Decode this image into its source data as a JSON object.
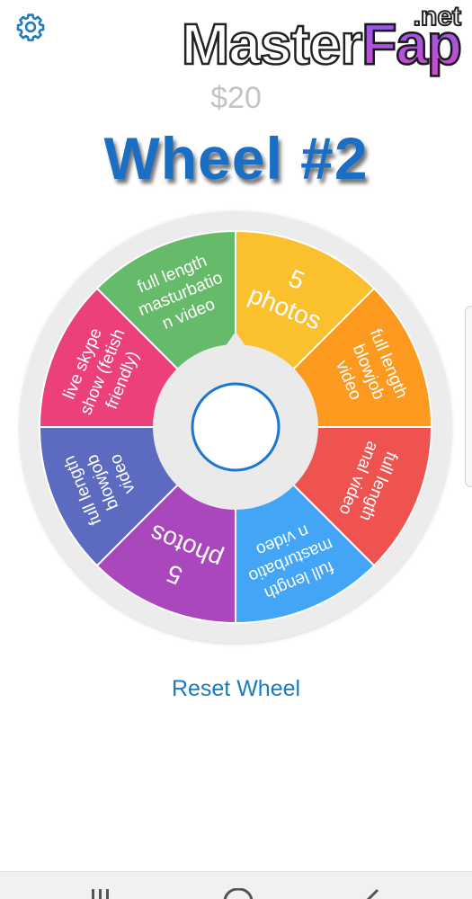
{
  "header": {
    "settings_icon": "gear-icon",
    "watermark_main_a": "Master",
    "watermark_main_b": "Fap",
    "watermark_suffix": ".net"
  },
  "price": "$20",
  "title": "Wheel #2",
  "wheel": {
    "segments": [
      {
        "lines": [
          "full length",
          "masturbatio",
          "n video"
        ],
        "color": "#66bb6a"
      },
      {
        "lines": [
          "5",
          "photos"
        ],
        "color": "#fbc02d"
      },
      {
        "lines": [
          "full length",
          "blowjob",
          "video"
        ],
        "color": "#fb9a1e"
      },
      {
        "lines": [
          "full length",
          "anal video"
        ],
        "color": "#ef5350"
      },
      {
        "lines": [
          "full length",
          "masturbatio",
          "n video"
        ],
        "color": "#42a5f5"
      },
      {
        "lines": [
          "5",
          "photos"
        ],
        "color": "#ab47bc"
      },
      {
        "lines": [
          "full length",
          "blowjob",
          "video"
        ],
        "color": "#5c6bc0"
      },
      {
        "lines": [
          "live skype",
          "show (fetish",
          "friendly)"
        ],
        "color": "#ec407a"
      }
    ],
    "rim_color": "#ececec",
    "hub_color": "#eaeaea",
    "center_ring_color": "#1976d2"
  },
  "reset_label": "Reset Wheel",
  "system_nav": {
    "items": [
      "recent-apps-icon",
      "home-icon",
      "back-icon"
    ]
  }
}
